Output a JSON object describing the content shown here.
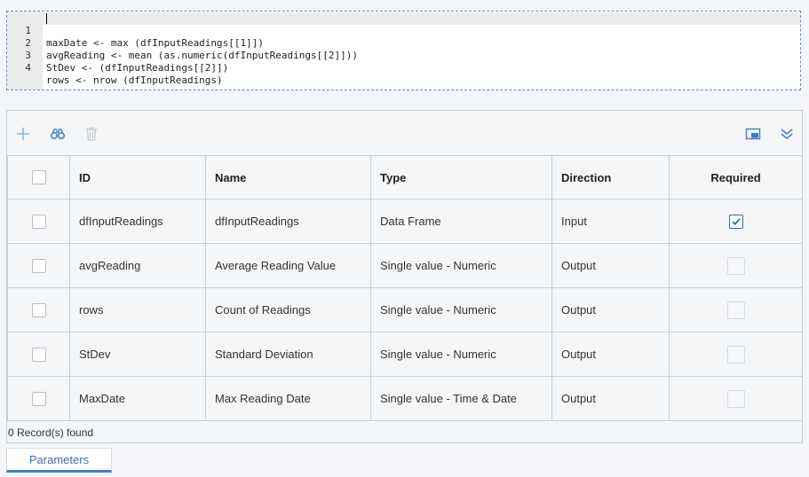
{
  "editor": {
    "lines": [
      {
        "num": "1",
        "text": "maxDate <- max (dfInputReadings[[1]])"
      },
      {
        "num": "2",
        "text": "avgReading <- mean (as.numeric(dfInputReadings[[2]]))"
      },
      {
        "num": "3",
        "text": "StDev <- (dfInputReadings[[2]])"
      },
      {
        "num": "4",
        "text": "rows <- nrow (dfInputReadings)"
      }
    ]
  },
  "toolbar": {
    "icons": [
      "plus-icon",
      "binoculars-icon",
      "trash-icon",
      "window-icon",
      "double-chevron-down-icon"
    ],
    "accent_color": "#3b7fd0"
  },
  "table": {
    "headers": {
      "id": "ID",
      "name": "Name",
      "type": "Type",
      "direction": "Direction",
      "required": "Required"
    },
    "rows": [
      {
        "id": "dfInputReadings",
        "name": "dfInputReadings",
        "type": "Data Frame",
        "direction": "Input",
        "required": true
      },
      {
        "id": "avgReading",
        "name": "Average Reading Value",
        "type": "Single value - Numeric",
        "direction": "Output",
        "required": false
      },
      {
        "id": "rows",
        "name": "Count of Readings",
        "type": "Single value - Numeric",
        "direction": "Output",
        "required": false
      },
      {
        "id": "StDev",
        "name": "Standard Deviation",
        "type": "Single value - Numeric",
        "direction": "Output",
        "required": false
      },
      {
        "id": "MaxDate",
        "name": "Max Reading Date",
        "type": "Single value - Time & Date",
        "direction": "Output",
        "required": false
      }
    ]
  },
  "footer": {
    "records": "0 Record(s) found"
  },
  "tabs": [
    {
      "label": "Parameters",
      "active": true
    }
  ]
}
